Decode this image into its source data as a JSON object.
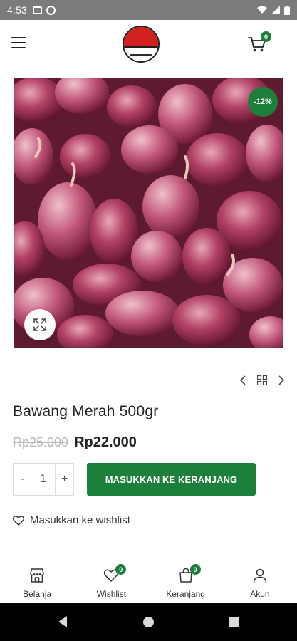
{
  "status_bar": {
    "time": "4:53"
  },
  "header": {
    "cart_count": "0"
  },
  "product": {
    "discount": "-12%",
    "title": "Bawang Merah 500gr",
    "old_price": "Rp25.000",
    "price": "Rp22.000",
    "quantity": "1",
    "qty_minus": "-",
    "qty_plus": "+",
    "add_to_cart": "MASUKKAN KE KERANJANG",
    "wishlist": "Masukkan ke wishlist"
  },
  "bottom_nav": {
    "items": [
      {
        "label": "Belanja",
        "icon": "store-icon"
      },
      {
        "label": "Wishlist",
        "icon": "heart-icon",
        "badge": "0"
      },
      {
        "label": "Keranjang",
        "icon": "bag-icon",
        "badge": "0"
      },
      {
        "label": "Akun",
        "icon": "user-icon"
      }
    ]
  },
  "colors": {
    "accent": "#1c7f3b",
    "old_price": "#bbbbbb",
    "status_bar": "#7b7b7b"
  }
}
